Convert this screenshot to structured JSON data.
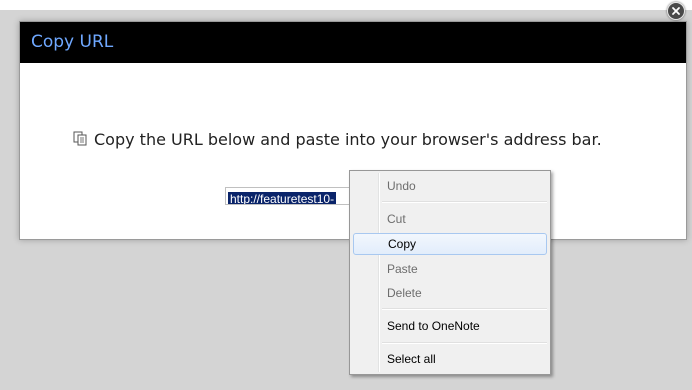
{
  "dialog": {
    "title": "Copy URL",
    "instruction": "Copy the URL below and paste into your browser's address bar.",
    "url_visible_text": "http://featuretest10-",
    "close_icon": "close-icon",
    "instruction_icon": "clipboard-icon"
  },
  "context_menu": {
    "items": [
      {
        "label": "Undo",
        "enabled": false
      },
      {
        "label": "Cut",
        "enabled": false
      },
      {
        "label": "Copy",
        "enabled": true,
        "highlighted": true
      },
      {
        "label": "Paste",
        "enabled": false
      },
      {
        "label": "Delete",
        "enabled": false
      },
      {
        "label": "Send to OneNote",
        "enabled": true
      },
      {
        "label": "Select all",
        "enabled": true
      }
    ]
  },
  "colors": {
    "titlebar_bg": "#000000",
    "title_text": "#6fa8ff",
    "selection_bg": "#0a246a",
    "overlay_bg": "#d4d4d4"
  }
}
